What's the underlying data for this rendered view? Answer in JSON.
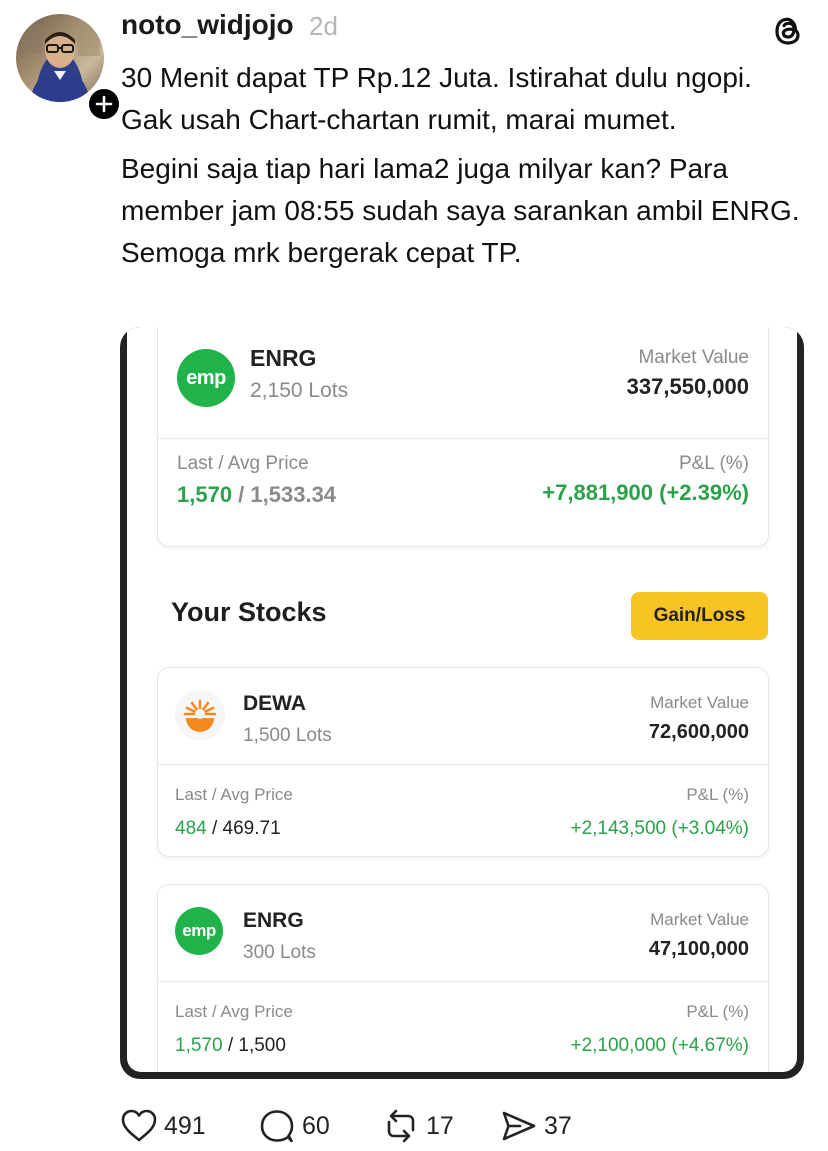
{
  "post": {
    "username": "noto_widjojo",
    "age": "2d",
    "paragraph1": "30 Menit dapat TP Rp.12 Juta. Istirahat dulu ngopi. Gak usah  Chart-chartan rumit, marai mumet.",
    "paragraph2": "Begini saja tiap hari lama2 juga milyar kan?  Para member jam 08:55  sudah saya sarankan ambil ENRG. Semoga mrk bergerak cepat TP."
  },
  "screenshot": {
    "top_card": {
      "logo_text": "emp",
      "ticker": "ENRG",
      "lots": "2,150 Lots",
      "market_value_label": "Market Value",
      "market_value": "337,550,000",
      "price_label": "Last / Avg Price",
      "last_price": "1,570",
      "avg_price": "1,533.34",
      "pl_label": "P&L (%)",
      "pl_value": "+7,881,900 (+2.39%)"
    },
    "section_title": "Your Stocks",
    "gain_loss_button": "Gain/Loss",
    "stocks": [
      {
        "logo": "dewa-logo",
        "ticker": "DEWA",
        "lots": "1,500 Lots",
        "market_value_label": "Market Value",
        "market_value": "72,600,000",
        "price_label": "Last / Avg Price",
        "last_price": "484",
        "avg_price": "469.71",
        "pl_label": "P&L (%)",
        "pl_value": "+2,143,500 (+3.04%)"
      },
      {
        "logo_text": "emp",
        "ticker": "ENRG",
        "lots": "300 Lots",
        "market_value_label": "Market Value",
        "market_value": "47,100,000",
        "price_label": "Last / Avg Price",
        "last_price": "1,570",
        "avg_price": "1,500",
        "pl_label": "P&L (%)",
        "pl_value": "+2,100,000 (+4.67%)"
      }
    ]
  },
  "actions": {
    "likes": "491",
    "comments": "60",
    "reposts": "17",
    "shares": "37"
  },
  "colors": {
    "gain_green": "#2aa249",
    "emp_green": "#1fb34a",
    "button_yellow": "#f8c424",
    "dewa_orange": "#f28a1e"
  },
  "icons": [
    "plus-icon",
    "threads-logo-icon",
    "heart-icon",
    "comment-icon",
    "repost-icon",
    "share-icon"
  ]
}
